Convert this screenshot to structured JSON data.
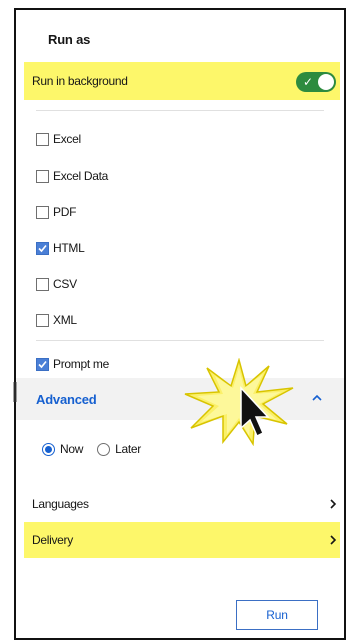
{
  "panel": {
    "title": "Run as",
    "background": {
      "label": "Run in background",
      "enabled": true
    },
    "formats": [
      {
        "label": "Excel",
        "checked": false
      },
      {
        "label": "Excel Data",
        "checked": false
      },
      {
        "label": "PDF",
        "checked": false
      },
      {
        "label": "HTML",
        "checked": true
      },
      {
        "label": "CSV",
        "checked": false
      },
      {
        "label": "XML",
        "checked": false
      }
    ],
    "prompt": {
      "label": "Prompt me",
      "checked": true
    },
    "advanced": {
      "title": "Advanced",
      "expanded": true,
      "options": [
        {
          "label": "Now",
          "selected": true
        },
        {
          "label": "Later",
          "selected": false
        }
      ]
    },
    "languages_label": "Languages",
    "delivery_label": "Delivery",
    "run_label": "Run"
  },
  "colors": {
    "accent": "#1660d0",
    "highlight": "#fdf76a",
    "toggle_on": "#2d8b3f",
    "checkbox_on": "#4a7fd6"
  },
  "icons": [
    "check-icon",
    "chevron-up-icon",
    "chevron-right-icon",
    "cursor-arrow-icon",
    "starburst-icon"
  ]
}
